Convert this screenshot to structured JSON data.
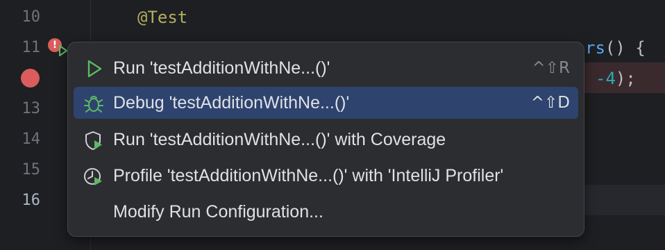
{
  "editor": {
    "line_numbers": [
      "10",
      "11",
      "13",
      "14",
      "15",
      "16"
    ],
    "code": {
      "annotation": "@Test",
      "line11_method_tail": "rs",
      "line11_tail": "() {",
      "line12_num": "-4",
      "line12_tail": ");"
    }
  },
  "menu": {
    "items": [
      {
        "label": "Run 'testAdditionWithNe...()'",
        "shortcut": "^⇧R",
        "icon": "run-icon"
      },
      {
        "label": "Debug 'testAdditionWithNe...()'",
        "shortcut": "^⇧D",
        "icon": "debug-icon",
        "selected": true
      },
      {
        "label": "Run 'testAdditionWithNe...()' with Coverage",
        "shortcut": "",
        "icon": "coverage-icon"
      },
      {
        "label": "Profile 'testAdditionWithNe...()' with 'IntelliJ Profiler'",
        "shortcut": "",
        "icon": "profiler-icon"
      },
      {
        "label": "Modify Run Configuration...",
        "shortcut": "",
        "icon": ""
      }
    ]
  },
  "colors": {
    "background": "#1e1f22",
    "popup": "#2b2d30",
    "selection": "#2e436e",
    "run_green": "#5fb865",
    "breakpoint_red": "#db5c5c"
  },
  "gutter": {
    "error_badge": "!"
  }
}
